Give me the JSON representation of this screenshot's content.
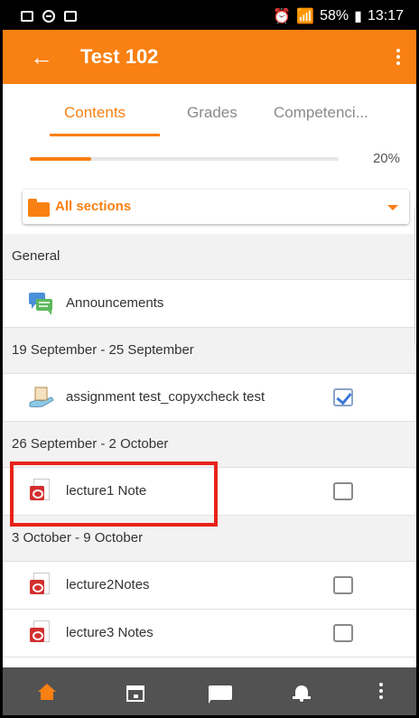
{
  "status_bar": {
    "battery": "58%",
    "time": "13:17"
  },
  "app_bar": {
    "title": "Test 102"
  },
  "tabs": [
    {
      "label": "Contents",
      "active": true
    },
    {
      "label": "Grades",
      "active": false
    },
    {
      "label": "Competenci...",
      "active": false
    }
  ],
  "progress": {
    "value": 0.2,
    "label": "20%"
  },
  "section_selector": {
    "label": "All sections"
  },
  "sections": [
    {
      "title": "General",
      "items": [
        {
          "label": "Announcements",
          "icon": "forum-icon",
          "has_checkbox": false
        }
      ]
    },
    {
      "title": "19 September - 25 September",
      "items": [
        {
          "label": "assignment test_copyxcheck test",
          "icon": "assignment-icon",
          "has_checkbox": true,
          "checked": true
        }
      ]
    },
    {
      "title": "26 September - 2 October",
      "items": [
        {
          "label": "lecture1 Note",
          "icon": "pdf-icon",
          "has_checkbox": true,
          "checked": false
        }
      ]
    },
    {
      "title": "3 October - 9 October",
      "items": [
        {
          "label": "lecture2Notes",
          "icon": "pdf-icon",
          "has_checkbox": true,
          "checked": false
        },
        {
          "label": "lecture3 Notes",
          "icon": "pdf-icon",
          "has_checkbox": true,
          "checked": false
        }
      ]
    }
  ],
  "colors": {
    "accent": "#f98012",
    "highlight": "#e8231a",
    "bottom_nav": "#525252"
  },
  "bottom_nav": [
    {
      "name": "home",
      "active": true
    },
    {
      "name": "calendar",
      "active": false
    },
    {
      "name": "messages",
      "active": false
    },
    {
      "name": "notifications",
      "active": false
    },
    {
      "name": "more",
      "active": false
    }
  ]
}
